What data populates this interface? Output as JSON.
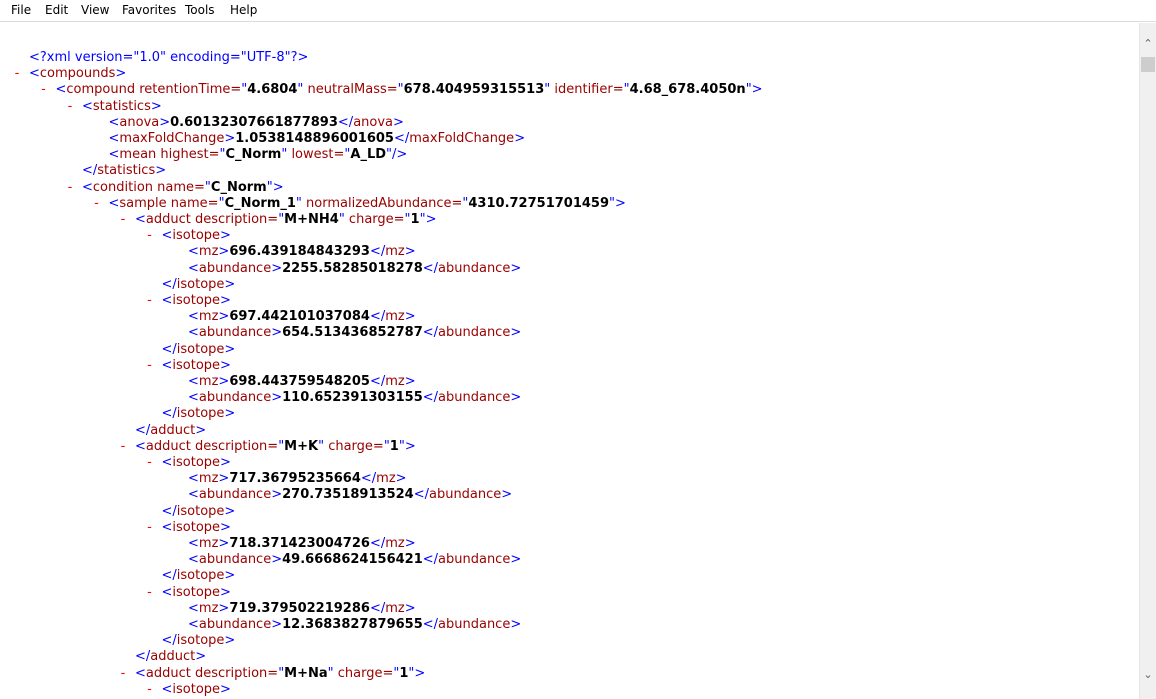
{
  "menu": [
    "File",
    "Edit",
    "View",
    "Favorites",
    "Tools",
    "Help"
  ],
  "xml_declaration": "<?xml version=\"1.0\" encoding=\"UTF-8\"?>",
  "compound": {
    "retentionTime": "4.6804",
    "neutralMass": "678.404959315513",
    "identifier": "4.68_678.4050n"
  },
  "statistics": {
    "anova": "0.60132307661877893",
    "maxFoldChange": "1.0538148896001605",
    "mean_highest": "C_Norm",
    "mean_lowest": "A_LD"
  },
  "condition": {
    "name": "C_Norm"
  },
  "sample": {
    "name": "C_Norm_1",
    "normalizedAbundance": "4310.72751701459"
  },
  "adducts": [
    {
      "description": "M+NH4",
      "charge": "1",
      "isotopes": [
        {
          "mz": "696.439184843293",
          "abundance": "2255.58285018278"
        },
        {
          "mz": "697.442101037084",
          "abundance": "654.513436852787"
        },
        {
          "mz": "698.443759548205",
          "abundance": "110.652391303155"
        }
      ]
    },
    {
      "description": "M+K",
      "charge": "1",
      "isotopes": [
        {
          "mz": "717.36795235664",
          "abundance": "270.73518913524"
        },
        {
          "mz": "718.371423004726",
          "abundance": "49.6668624156421"
        },
        {
          "mz": "719.379502219286",
          "abundance": "12.3683827879655"
        }
      ]
    },
    {
      "description": "M+Na",
      "charge": "1",
      "isotopes": []
    }
  ],
  "colors": {
    "bracket": "#0000ff",
    "tag_name": "#990000",
    "value": "#000000",
    "toggle": "#ff0000"
  },
  "icons": {
    "scroll_up": "chevron-up-icon",
    "scroll_down": "chevron-down-icon"
  }
}
